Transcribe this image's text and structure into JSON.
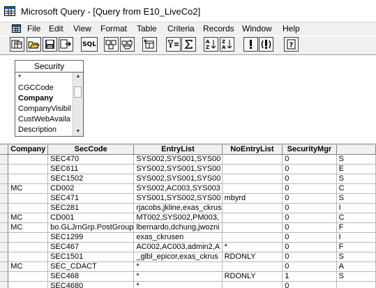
{
  "window": {
    "title": "Microsoft Query - [Query from E10_LiveCo2]"
  },
  "menu": [
    "File",
    "Edit",
    "View",
    "Format",
    "Table",
    "Criteria",
    "Records",
    "Window",
    "Help"
  ],
  "toolbar": {
    "sql_label": "SQL"
  },
  "table_box": {
    "title": "Security",
    "fields": [
      "*",
      "CGCCode",
      "Company",
      "CompanyVisibil",
      "CustWebAvaila",
      "Description"
    ]
  },
  "grid": {
    "columns": [
      "Company",
      "SecCode",
      "EntryList",
      "NoEntryList",
      "SecurityMgr",
      ""
    ],
    "rows": [
      [
        "",
        "SEC470",
        "SYS002,SYS001,SYS00",
        "",
        "0",
        "S"
      ],
      [
        "",
        "SEC611",
        "SYS002,SYS001,SYS00",
        "",
        "0",
        "E"
      ],
      [
        "",
        "SEC1502",
        "SYS002,SYS001,SYS00",
        "",
        "0",
        "S"
      ],
      [
        "MC",
        "CD002",
        "SYS002,AC003,SYS003",
        "",
        "0",
        "C"
      ],
      [
        "",
        "SEC471",
        "SYS001,SYS002,SYS00",
        "mbyrd",
        "0",
        "S"
      ],
      [
        "",
        "SEC281",
        "rjacobs,jkline,exas_ckrus",
        "",
        "0",
        "I"
      ],
      [
        "MC",
        "CD001",
        "MT002,SYS002,PM003,",
        "",
        "0",
        "C"
      ],
      [
        "MC",
        "bo.GLJrnGrp.PostGroup",
        "lbernardo,dchung,jwozni",
        "",
        "0",
        "F"
      ],
      [
        "",
        "SEC1299",
        "exas_ckrusen",
        "",
        "0",
        "I"
      ],
      [
        "",
        "SEC467",
        "AC002,AC003,admin2,A",
        "*",
        "0",
        "F"
      ],
      [
        "",
        "SEC1501",
        "_glbl_epicor,exas_ckrus",
        "RDONLY",
        "0",
        "S"
      ],
      [
        "MC",
        "SEC_CDACT",
        "*",
        "",
        "0",
        "A"
      ],
      [
        "",
        "SEC468",
        "*",
        "RDONLY",
        "1",
        "S"
      ],
      [
        "",
        "SEC4680",
        "*",
        "",
        "0",
        ""
      ]
    ],
    "current_row": 8
  }
}
